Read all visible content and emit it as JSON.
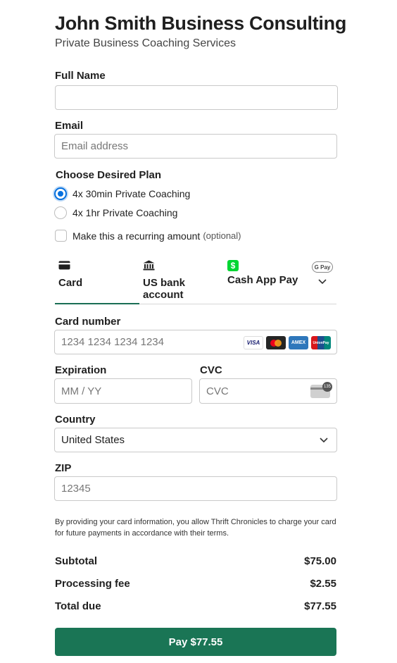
{
  "header": {
    "title": "John Smith Business Consulting",
    "subtitle": "Private Business Coaching Services"
  },
  "form": {
    "full_name": {
      "label": "Full Name",
      "value": ""
    },
    "email": {
      "label": "Email",
      "placeholder": "Email address"
    },
    "plan": {
      "label": "Choose Desired Plan",
      "options": [
        {
          "label": "4x 30min Private Coaching",
          "selected": true
        },
        {
          "label": "4x 1hr Private Coaching",
          "selected": false
        }
      ]
    },
    "recurring": {
      "label": "Make this a recurring amount",
      "optional": "(optional)",
      "checked": false
    }
  },
  "payment_tabs": [
    {
      "label": "Card",
      "icon": "card-icon",
      "active": true
    },
    {
      "label": "US bank account",
      "icon": "bank-icon",
      "active": false
    },
    {
      "label": "Cash App Pay",
      "icon": "cash-app-icon",
      "active": false
    },
    {
      "label": "G Pay",
      "icon": "google-pay-icon",
      "active": false
    }
  ],
  "card": {
    "number_label": "Card number",
    "number_placeholder": "1234 1234 1234 1234",
    "brands": [
      "VISA",
      "Mastercard",
      "AMEX",
      "UnionPay"
    ],
    "expiration_label": "Expiration",
    "expiration_placeholder": "MM / YY",
    "cvc_label": "CVC",
    "cvc_placeholder": "CVC",
    "cvc_badge": "135",
    "country_label": "Country",
    "country_value": "United States",
    "zip_label": "ZIP",
    "zip_placeholder": "12345"
  },
  "notice": "By providing your card information, you allow Thrift Chronicles to charge your card for future payments in accordance with their terms.",
  "summary": {
    "subtotal_label": "Subtotal",
    "subtotal_value": "$75.00",
    "fee_label": "Processing fee",
    "fee_value": "$2.55",
    "total_label": "Total due",
    "total_value": "$77.55"
  },
  "pay_button": "Pay $77.55",
  "colors": {
    "accent": "#1a7555",
    "radio_selected": "#0570de"
  }
}
